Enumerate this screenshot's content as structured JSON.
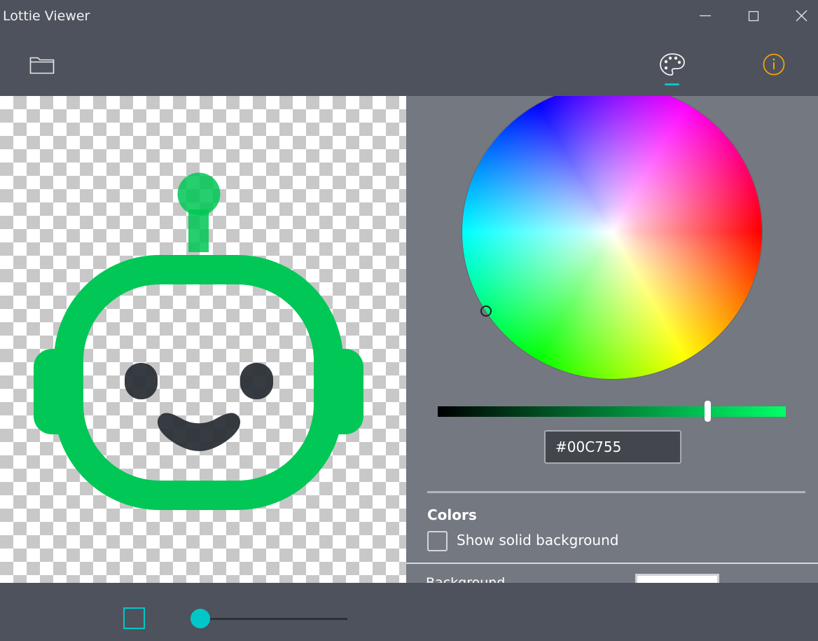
{
  "window": {
    "title": "Lottie Viewer"
  },
  "toolbar": {
    "open_icon": "folder-icon",
    "palette_icon": "palette-icon",
    "info_icon": "info-icon",
    "accent_color": "#00c8c8",
    "info_color": "#f0a30a"
  },
  "color_picker": {
    "hex_value": "#00C755",
    "brightness_fraction": 0.78
  },
  "colors_section": {
    "heading": "Colors",
    "solid_background_label": "Show solid background",
    "solid_background_checked": false,
    "background_label": "Background",
    "background_color": "#ffffff"
  },
  "animation": {
    "primary_color": "#00c755",
    "face_color": "#2c3038"
  },
  "playback": {
    "stop_icon": "stop-icon",
    "progress_fraction": 0.0
  }
}
